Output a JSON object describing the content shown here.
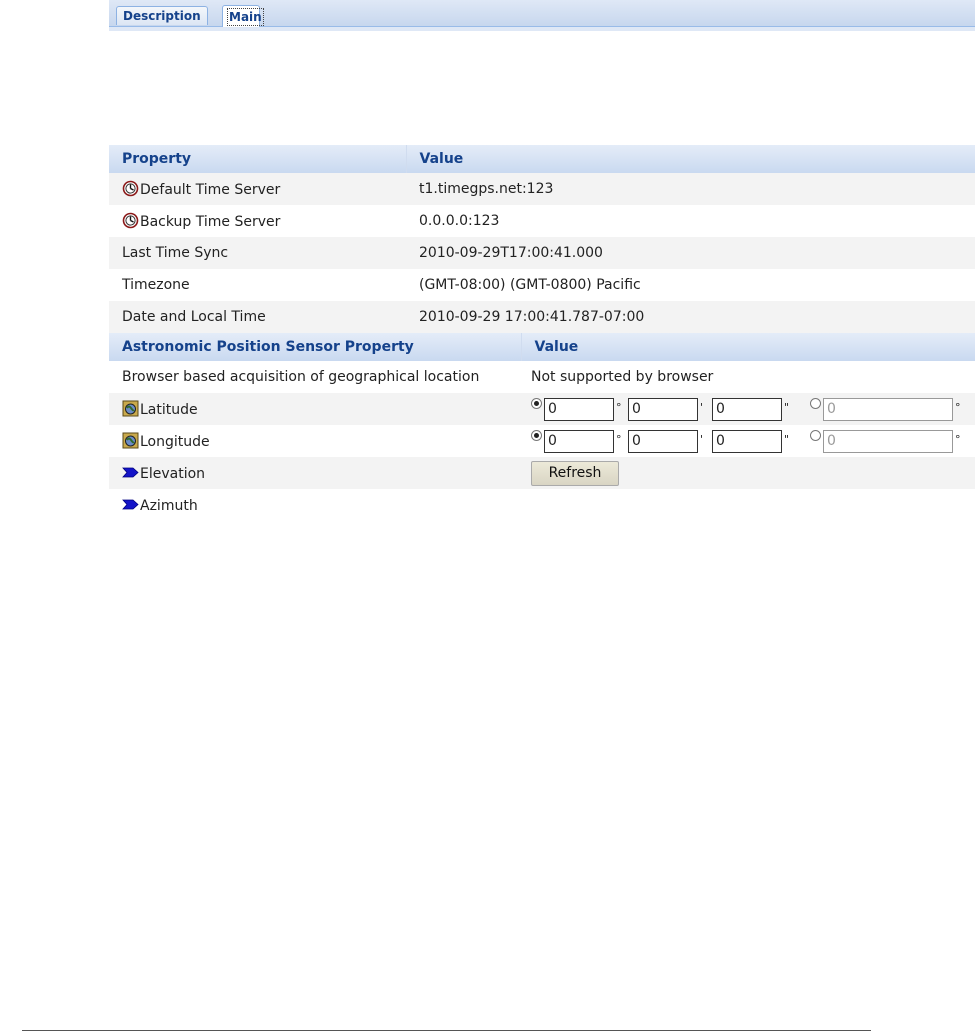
{
  "tabs": [
    {
      "label": "Description",
      "active": false
    },
    {
      "label": "Main",
      "active": true
    }
  ],
  "time_table": {
    "headers": {
      "property": "Property",
      "value": "Value"
    },
    "rows": [
      {
        "icon": "clock-icon",
        "property": "Default Time Server",
        "value": "t1.timegps.net:123"
      },
      {
        "icon": "clock-icon",
        "property": "Backup Time Server",
        "value": "0.0.0.0:123"
      },
      {
        "icon": "",
        "property": "Last Time Sync",
        "value": "2010-09-29T17:00:41.000"
      },
      {
        "icon": "",
        "property": "Timezone",
        "value": "(GMT-08:00) (GMT-0800) Pacific"
      },
      {
        "icon": "",
        "property": "Date and Local Time",
        "value": "2010-09-29 17:00:41.787-07:00"
      }
    ]
  },
  "sensor_table": {
    "headers": {
      "property": "Astronomic Position Sensor Property",
      "value": "Value"
    },
    "acquisition": {
      "property": "Browser based acquisition of geographical location",
      "value": "Not supported by browser"
    },
    "latitude": {
      "label": "Latitude",
      "icon": "globe-icon",
      "deg": "0",
      "min": "0",
      "sec": "0",
      "decimal": "0",
      "mode": "dms"
    },
    "longitude": {
      "label": "Longitude",
      "icon": "globe-icon",
      "deg": "0",
      "min": "0",
      "sec": "0",
      "decimal": "0",
      "mode": "dms"
    },
    "elevation": {
      "label": "Elevation",
      "icon": "arrow-icon",
      "button": "Refresh"
    },
    "azimuth": {
      "label": "Azimuth",
      "icon": "arrow-icon"
    },
    "symbols": {
      "deg": "°",
      "min": "'",
      "sec": "\""
    }
  },
  "colors": {
    "header_text": "#15428b",
    "tab_bar": "#c7d7ee",
    "row_alt": "#f3f3f3"
  }
}
